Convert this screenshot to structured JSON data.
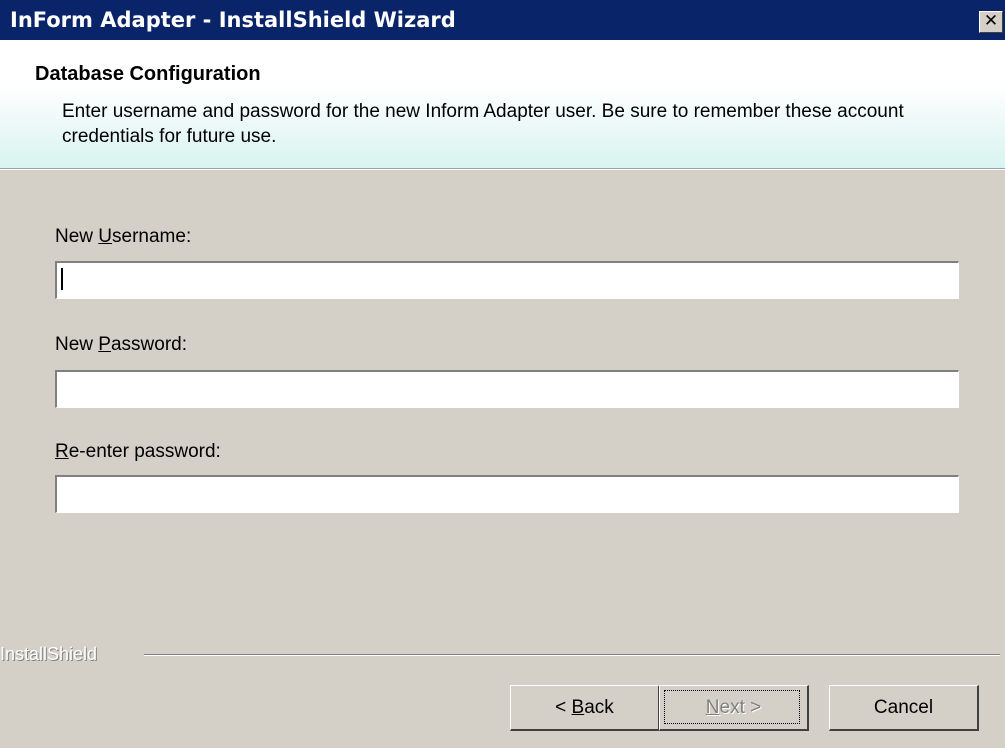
{
  "window": {
    "title": "InForm Adapter - InstallShield Wizard",
    "close_glyph": "✕"
  },
  "header": {
    "title": "Database Configuration",
    "description": "Enter username and password for the new Inform Adapter user.  Be sure to remember these account credentials for future use."
  },
  "form": {
    "username": {
      "label_pre": "New ",
      "label_key": "U",
      "label_post": "sername:",
      "value": ""
    },
    "password": {
      "label_pre": "New ",
      "label_key": "P",
      "label_post": "assword:",
      "value": ""
    },
    "reenter": {
      "label_pre": "",
      "label_key": "R",
      "label_post": "e-enter password:",
      "value": ""
    }
  },
  "footer": {
    "brand": "InstallShield"
  },
  "buttons": {
    "back": {
      "pre": "< ",
      "key": "B",
      "post": "ack"
    },
    "next": {
      "pre": "",
      "key": "N",
      "post": "ext >",
      "enabled": false
    },
    "cancel": {
      "label": "Cancel"
    }
  },
  "colors": {
    "titlebar": "#0a246a",
    "dialog_bg": "#d4d0c8",
    "header_gradient_end": "#d8f4f0"
  }
}
